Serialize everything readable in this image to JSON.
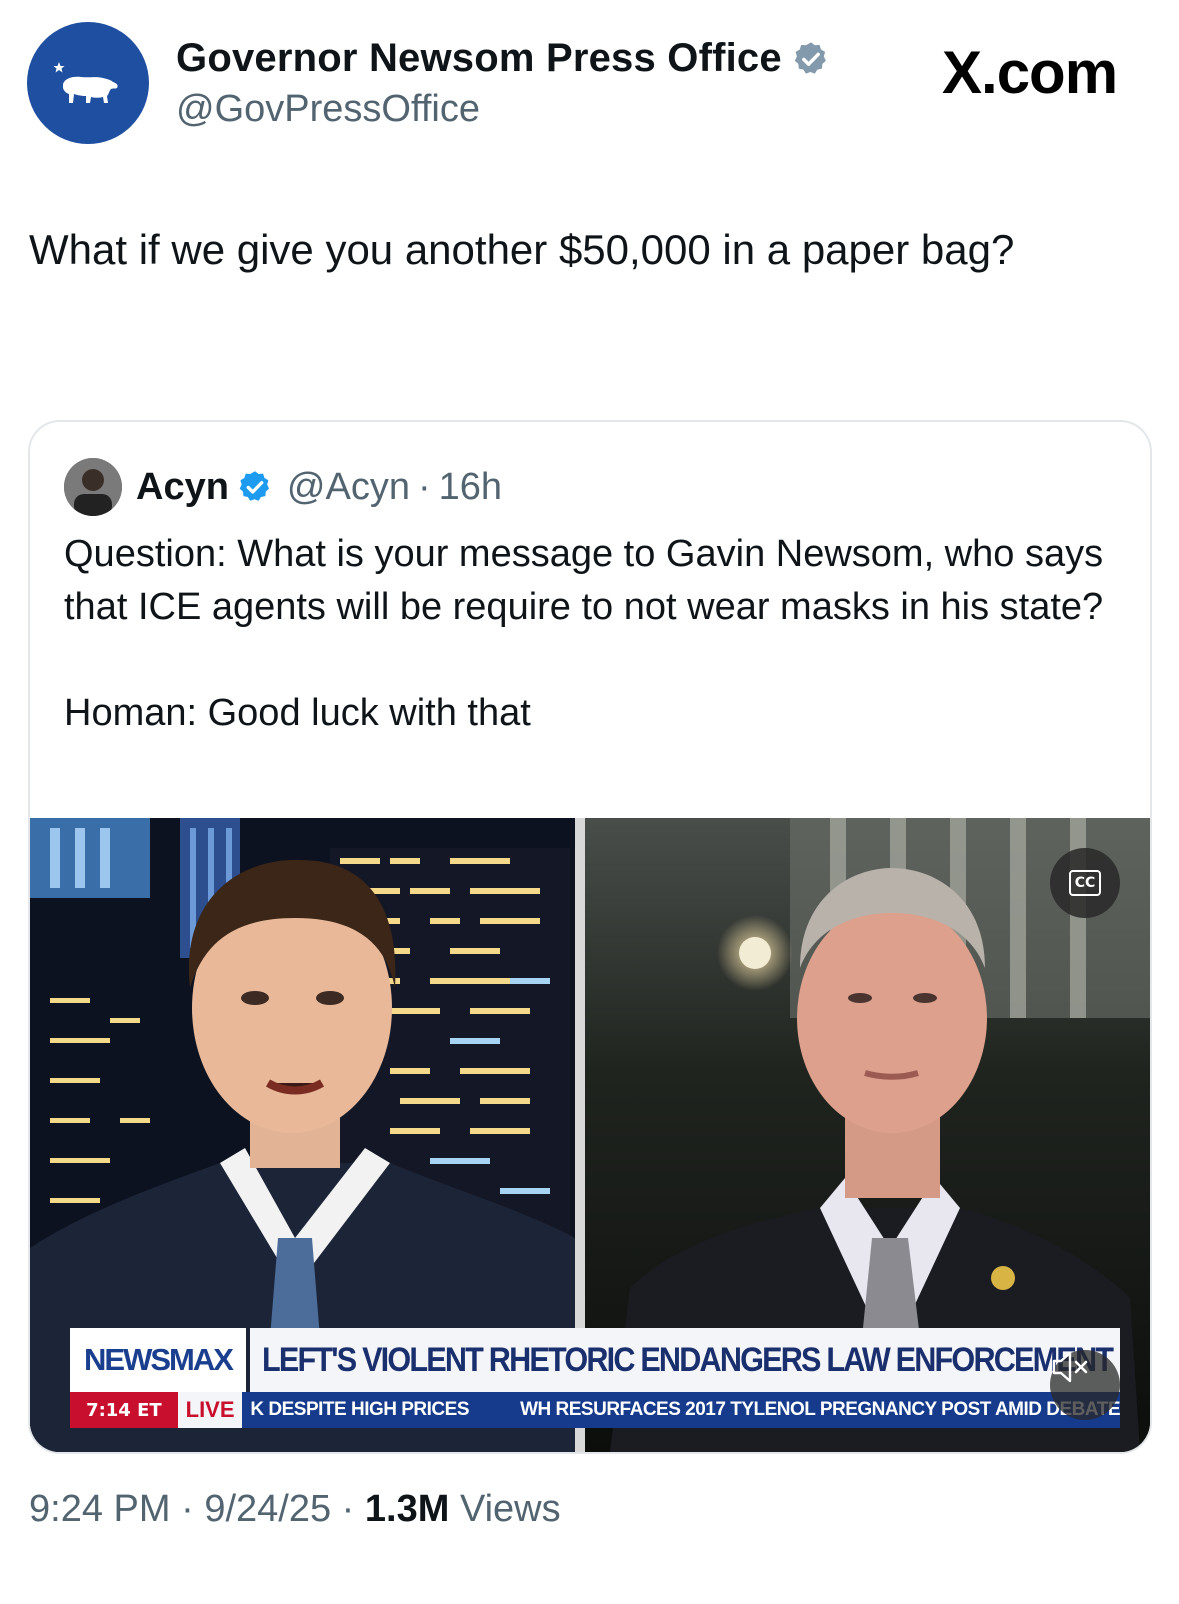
{
  "watermark": "X.com",
  "author": {
    "name": "Governor Newsom Press Office",
    "handle": "@GovPressOffice",
    "verified_color": "#829aab",
    "avatar_icon": "california-bear-icon",
    "avatar_bg": "#1f4fa0"
  },
  "tweet": {
    "text": "What if we give you another $50,000 in a paper bag?"
  },
  "quoted": {
    "name": "Acyn",
    "handle": "@Acyn",
    "separator": "·",
    "time": "16h",
    "verified_color": "#1d9bf0",
    "text_question": "Question: What is your message to Gavin Newsom, who says that ICE agents will be require to not wear masks in his state?",
    "text_answer": "Homan: Good luck with that",
    "video": {
      "network": "NEWSMAX",
      "headline": "LEFT'S VIOLENT RHETORIC ENDANGERS LAW ENFORCEMENT",
      "time": "7:14 ET",
      "live": "LIVE",
      "ticker_1": "K DESPITE HIGH PRICES",
      "ticker_2": "WH RESURFACES 2017 TYLENOL PREGNANCY POST AMID DEBATE",
      "cc_label": "CC",
      "brand_color": "#1b3f8f",
      "ticker_color": "#163a8c",
      "live_color": "#c8102e"
    }
  },
  "footer": {
    "time": "9:24 PM",
    "sep1": "·",
    "date": "9/24/25",
    "sep2": "·",
    "views_count": "1.3M",
    "views_label": "Views"
  }
}
